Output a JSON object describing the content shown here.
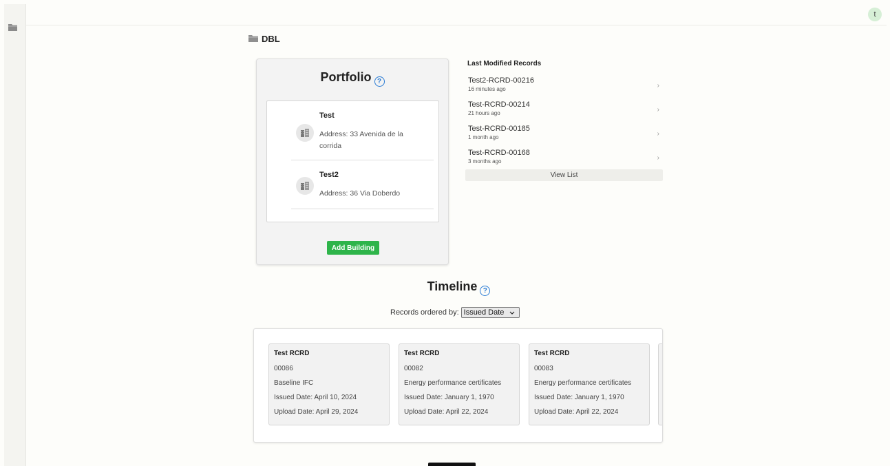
{
  "topbar": {
    "avatar_initial": "t"
  },
  "breadcrumb": {
    "label": "DBL"
  },
  "portfolio": {
    "title": "Portfolio",
    "help": "?",
    "buildings": [
      {
        "name": "Test",
        "address": "Address: 33 Avenida de la corrida"
      },
      {
        "name": "Test2",
        "address": "Address: 36 Via Doberdo"
      }
    ],
    "add_button": "Add Building"
  },
  "last_modified": {
    "title": "Last Modified Records",
    "items": [
      {
        "id": "Test2-RCRD-00216",
        "ago": "16 minutes ago"
      },
      {
        "id": "Test-RCRD-00214",
        "ago": "21 hours ago"
      },
      {
        "id": "Test-RCRD-00185",
        "ago": "1 month ago"
      },
      {
        "id": "Test-RCRD-00168",
        "ago": "3 months ago"
      }
    ],
    "view_list": "View List"
  },
  "timeline": {
    "title": "Timeline",
    "help": "?",
    "order_label": "Records ordered by:",
    "order_value": "Issued Date",
    "cards": [
      {
        "title": "Test RCRD",
        "number": "00086",
        "type": "Baseline IFC",
        "issued": "Issued Date: April 10, 2024",
        "upload": "Upload Date: April 29, 2024"
      },
      {
        "title": "Test RCRD",
        "number": "00082",
        "type": "Energy performance certificates",
        "issued": "Issued Date: January 1, 1970",
        "upload": "Upload Date: April 22, 2024"
      },
      {
        "title": "Test RCRD",
        "number": "00083",
        "type": "Energy performance certificates",
        "issued": "Issued Date: January 1, 1970",
        "upload": "Upload Date: April 22, 2024"
      }
    ]
  }
}
